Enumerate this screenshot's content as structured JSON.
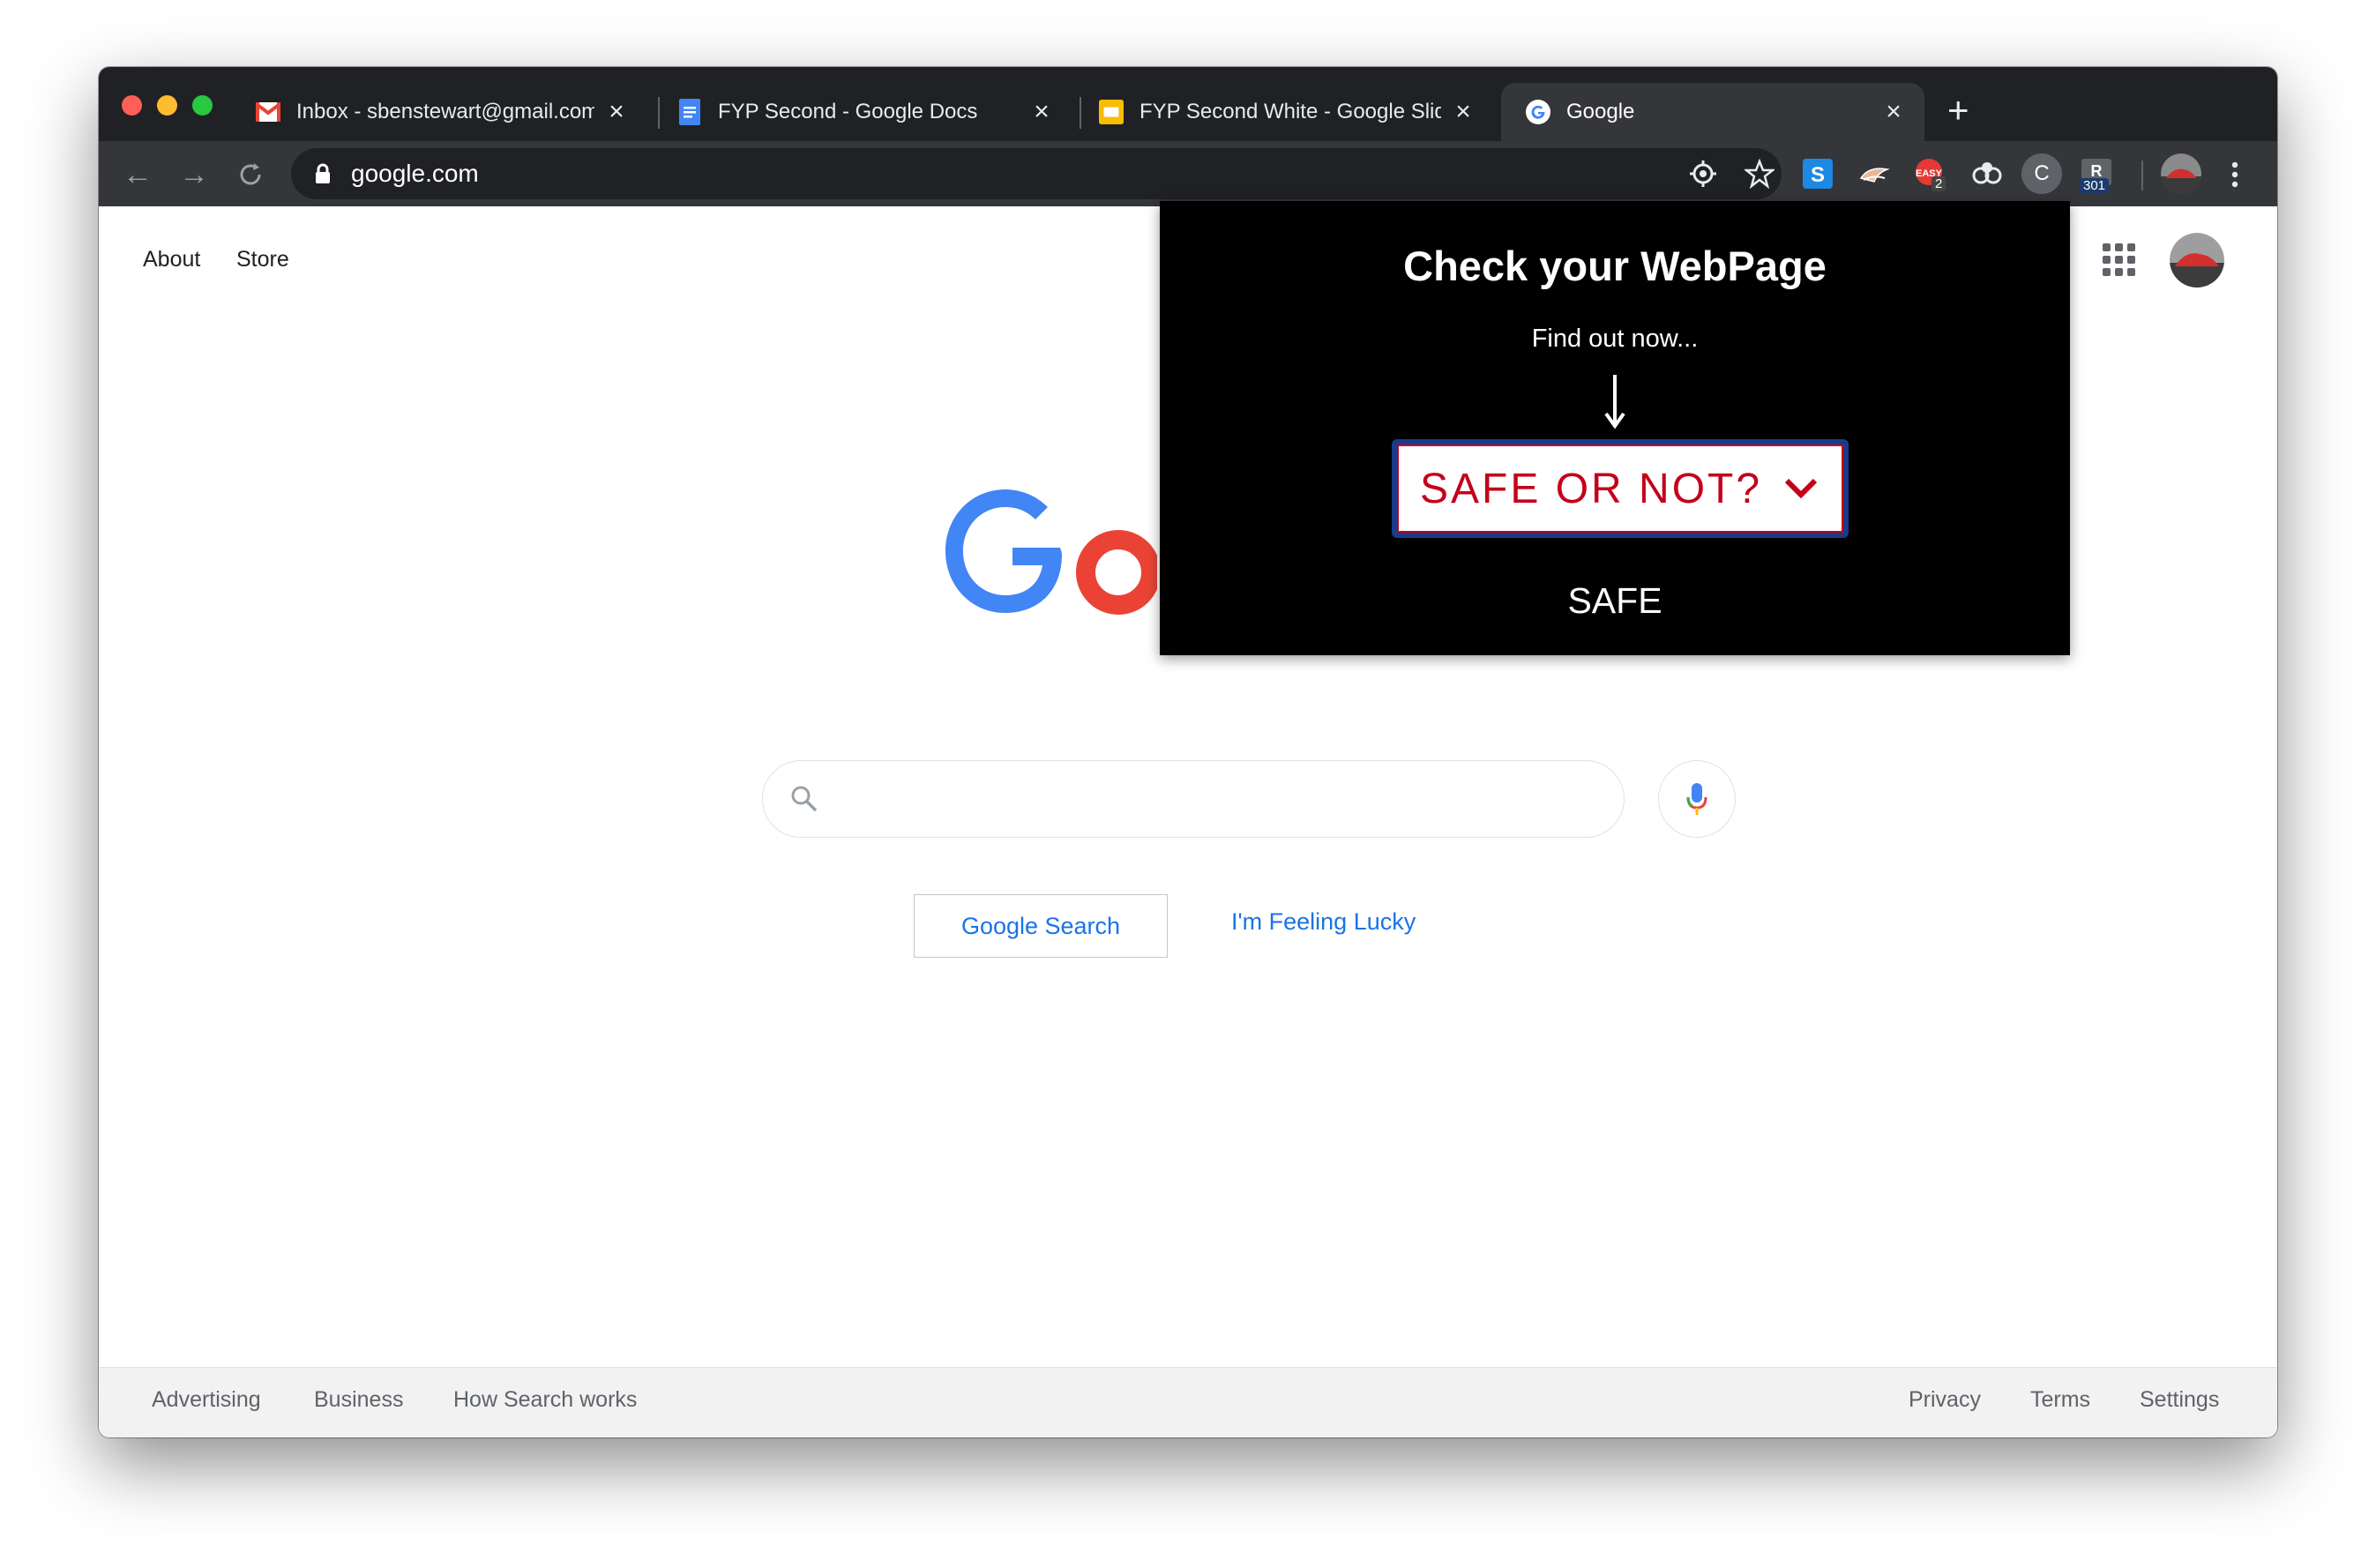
{
  "browser": {
    "tabs": [
      {
        "title": "Inbox - sbenstewart@gmail.com",
        "icon": "gmail-icon",
        "active": false
      },
      {
        "title": "FYP Second - Google Docs",
        "icon": "google-docs-icon",
        "active": false
      },
      {
        "title": "FYP Second White - Google Slides",
        "icon": "google-slides-icon",
        "active": false
      },
      {
        "title": "Google",
        "icon": "google-g-icon",
        "active": true
      }
    ],
    "url": "google.com",
    "extensions": [
      {
        "name": "S",
        "icon": "s-extension-icon"
      },
      {
        "name": "",
        "icon": "bird-extension-icon"
      },
      {
        "name": "EASY",
        "icon": "easy-extension-icon",
        "badge": "2"
      },
      {
        "name": "",
        "icon": "link-extension-icon"
      },
      {
        "name": "C",
        "icon": "c-extension-icon"
      },
      {
        "name": "R",
        "icon": "redirect-extension-icon",
        "badge": "301"
      }
    ]
  },
  "page": {
    "top_links": [
      "About",
      "Store"
    ],
    "logo_visible": "Go",
    "buttons": {
      "search": "Google Search",
      "lucky": "I'm Feeling Lucky"
    },
    "footer_left": [
      "Advertising",
      "Business",
      "How Search works"
    ],
    "footer_right": [
      "Privacy",
      "Terms",
      "Settings"
    ]
  },
  "popup": {
    "title": "Check your WebPage",
    "subtitle": "Find out now...",
    "select_label": "SAFE OR NOT?",
    "result": "SAFE"
  },
  "colors": {
    "google_blue": "#4285f4",
    "google_red": "#ea4335",
    "popup_bg": "#000000",
    "select_border": "#c4001a",
    "link_blue": "#1a73e8"
  }
}
